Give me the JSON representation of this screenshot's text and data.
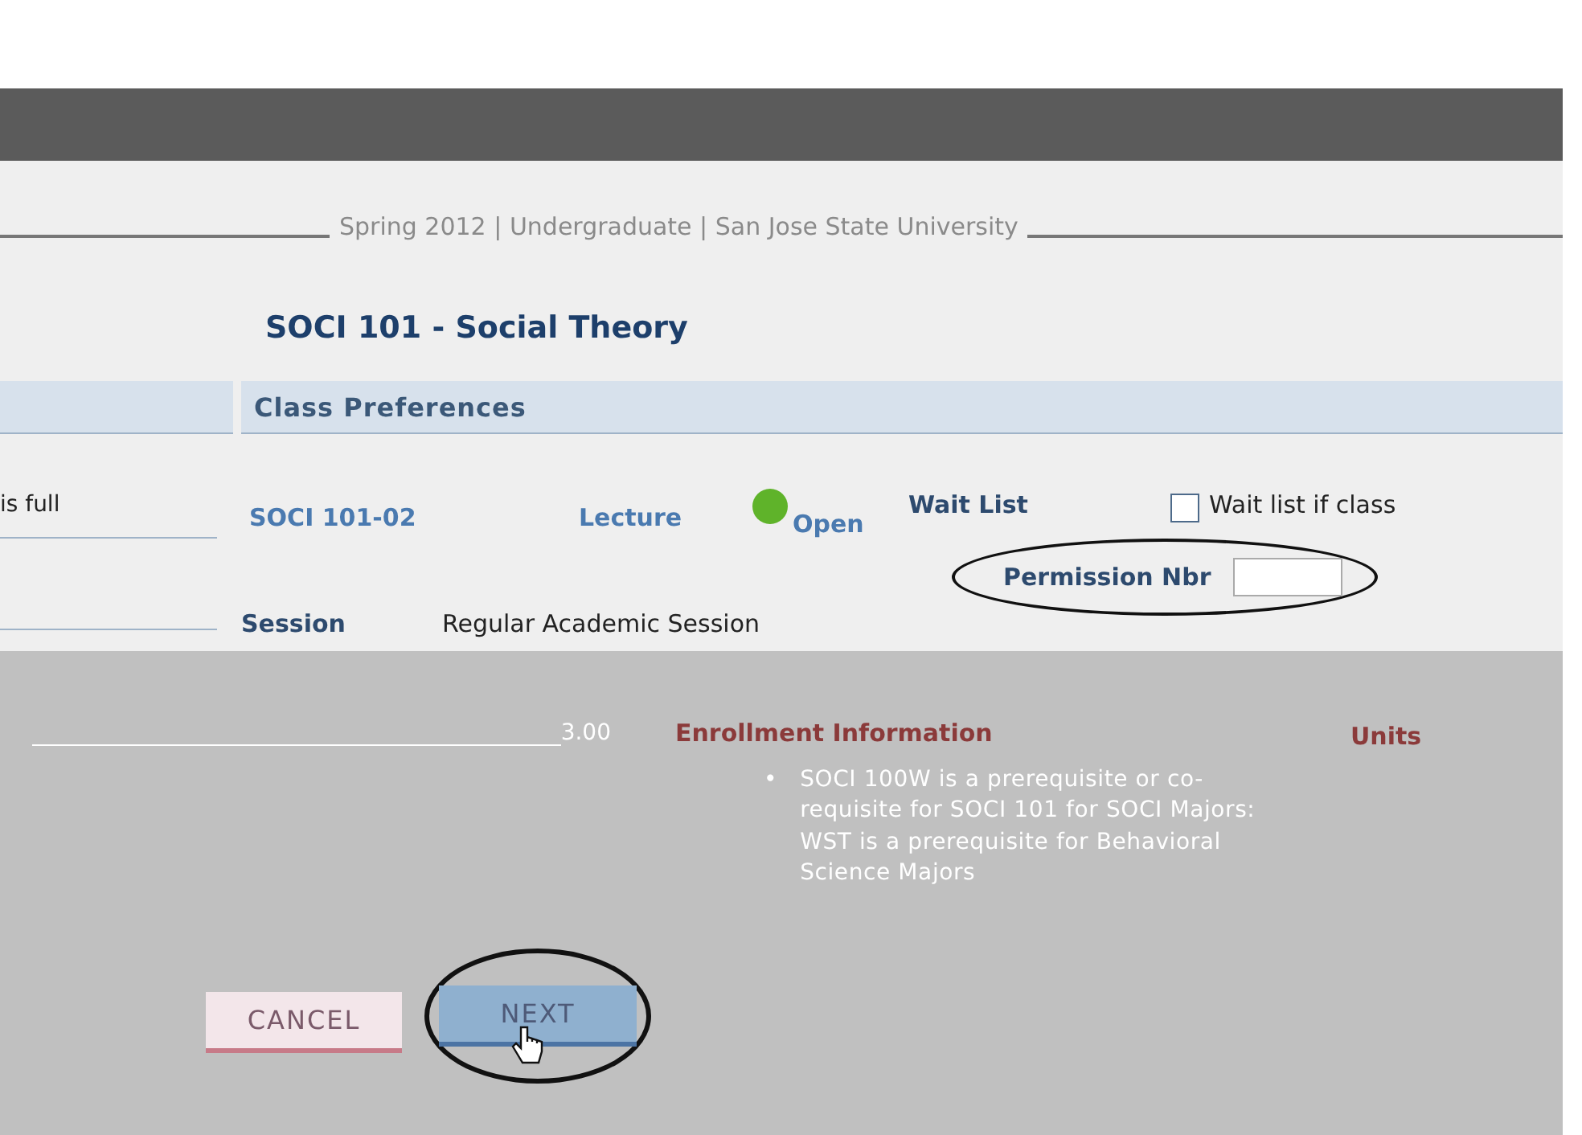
{
  "term_line": "Spring 2012 | Undergraduate | San Jose State University",
  "class_title": "SOCI  101 - Social Theory",
  "section_header": "Class Preferences",
  "left_column": {
    "status_text": "is full",
    "units_value": "3.00"
  },
  "class_row": {
    "section": "SOCI  101-02",
    "component": "Lecture",
    "status": "Open",
    "open": true
  },
  "wait_list": {
    "label": "Wait List",
    "checkbox_label": "Wait list if class",
    "checked": false
  },
  "permission": {
    "label": "Permission Nbr",
    "circled": true
  },
  "session": {
    "label": "Session",
    "value": "Regular Academic Session"
  },
  "enrollment_info": {
    "title": "Enrollment Information",
    "items": [
      {
        "bullet": "•",
        "text": "SOCI 100W is a prerequisite or co-requisite for SOCI 101 for SOCI Majors: WST is a prerequisite for Behavioral Science Majors"
      }
    ]
  },
  "units_label": "Units",
  "buttons": [
    {
      "label": "CANCEL",
      "kind": "secondary",
      "circled": false
    },
    {
      "label": "NEXT",
      "kind": "primary",
      "circled": true
    }
  ]
}
